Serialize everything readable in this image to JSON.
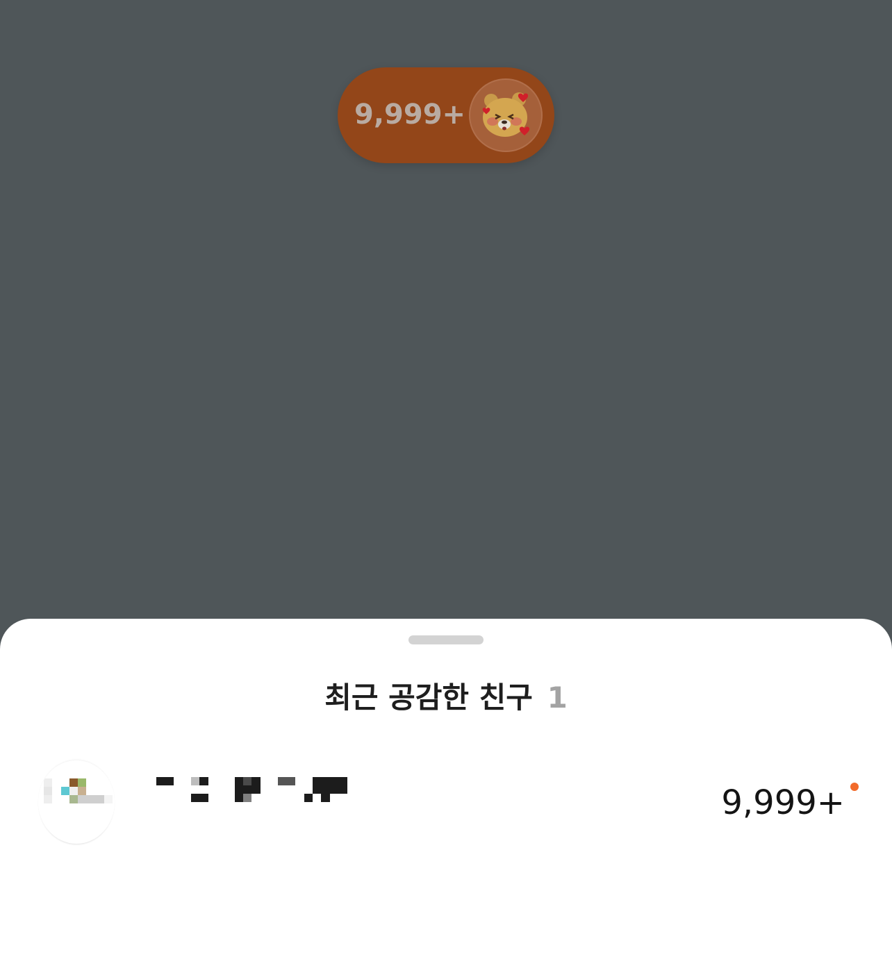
{
  "reaction_pill": {
    "count": "9,999+",
    "emoji_icon": "lion-with-hearts-emoji",
    "background_color": "#934619"
  },
  "sheet": {
    "title": "최근 공감한 친구",
    "title_count": "1",
    "friends": [
      {
        "name": "",
        "avatar_icon": "blurred-avatar",
        "reaction_count": "9,999+",
        "new_indicator": true,
        "new_indicator_color": "#f26a2a"
      }
    ]
  }
}
